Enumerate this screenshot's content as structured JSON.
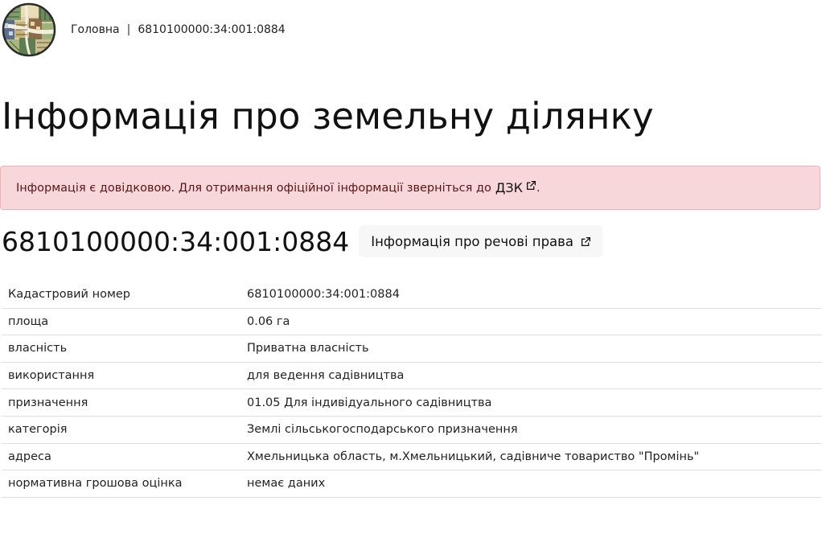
{
  "header": {
    "breadcrumb": {
      "home": "Головна",
      "separator": "|",
      "current": "6810100000:34:001:0884"
    }
  },
  "page": {
    "title": "Інформація про земельну ділянку"
  },
  "alert": {
    "text": "Інформація є довідковою. Для отримання офіційної інформації зверніться до",
    "link_text": "ДЗК",
    "end": ".",
    "icon": "external-link-icon"
  },
  "parcel": {
    "number": "6810100000:34:001:0884",
    "rights_button": "Інформація про речові права"
  },
  "table": {
    "rows": [
      {
        "label": "Кадастровий номер",
        "value": "6810100000:34:001:0884"
      },
      {
        "label": "площа",
        "value": "0.06 га"
      },
      {
        "label": "власність",
        "value": "Приватна власність"
      },
      {
        "label": "використання",
        "value": "для ведення садівництва"
      },
      {
        "label": "призначення",
        "value": "01.05 Для індивідуального садівництва"
      },
      {
        "label": "категорія",
        "value": "Землі сільськогосподарського призначення"
      },
      {
        "label": "адреса",
        "value": "Хмельницька область, м.Хмельницький, садівниче товариство \"Промінь\""
      },
      {
        "label": "нормативна грошова оцінка",
        "value": "немає даних"
      }
    ]
  },
  "colors": {
    "alert_bg": "#f8d7da",
    "alert_text": "#58151c",
    "button_bg": "#f7f7f7"
  }
}
